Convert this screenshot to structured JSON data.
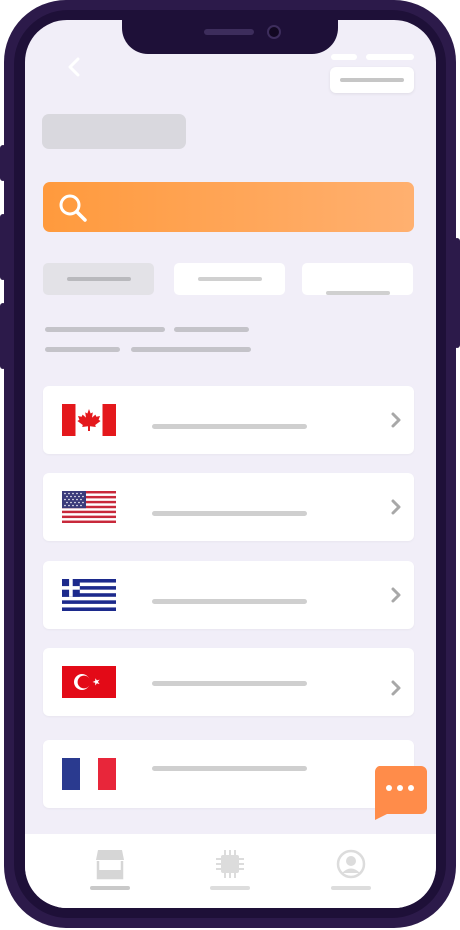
{
  "app": {
    "colors": {
      "frame": "#2c1a4a",
      "screen_bg": "#f1eef8",
      "accent_start": "#ff9a3d",
      "accent_end": "#ffb070",
      "chat_bubble": "#ff8c4a"
    }
  },
  "header": {
    "back_icon": "chevron-left-icon"
  },
  "search": {
    "icon": "search-icon"
  },
  "tabs": [
    {
      "icon": "placeholder",
      "active": true
    },
    {
      "icon": "placeholder",
      "active": false
    },
    {
      "icon": "placeholder",
      "active": false
    }
  ],
  "countries": [
    {
      "flag": "canada-flag-icon"
    },
    {
      "flag": "usa-flag-icon"
    },
    {
      "flag": "greece-flag-icon"
    },
    {
      "flag": "turkey-flag-icon"
    },
    {
      "flag": "france-flag-icon"
    }
  ],
  "chat": {
    "icon": "chat-bubble-icon"
  },
  "bottom_nav": [
    {
      "icon": "store-icon",
      "active": true
    },
    {
      "icon": "chip-icon",
      "active": false
    },
    {
      "icon": "user-icon",
      "active": false
    }
  ]
}
